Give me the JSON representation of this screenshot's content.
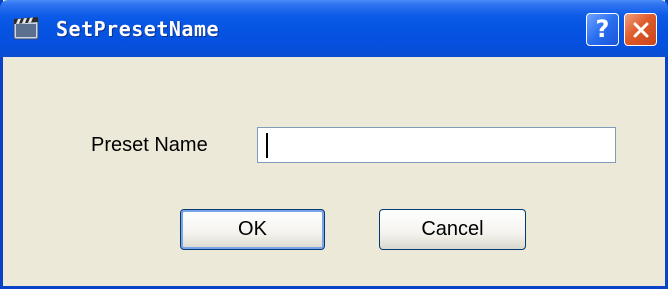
{
  "window": {
    "title": "SetPresetName",
    "app_icon": "clapperboard-icon",
    "help_label": "?",
    "close_icon": "close-icon"
  },
  "form": {
    "preset_name_label": "Preset Name",
    "preset_name_value": "",
    "preset_name_placeholder": ""
  },
  "buttons": {
    "ok_label": "OK",
    "cancel_label": "Cancel"
  },
  "colors": {
    "titlebar": "#0653e2",
    "dialog_background": "#ece9d8",
    "close_button": "#e05a2a"
  }
}
